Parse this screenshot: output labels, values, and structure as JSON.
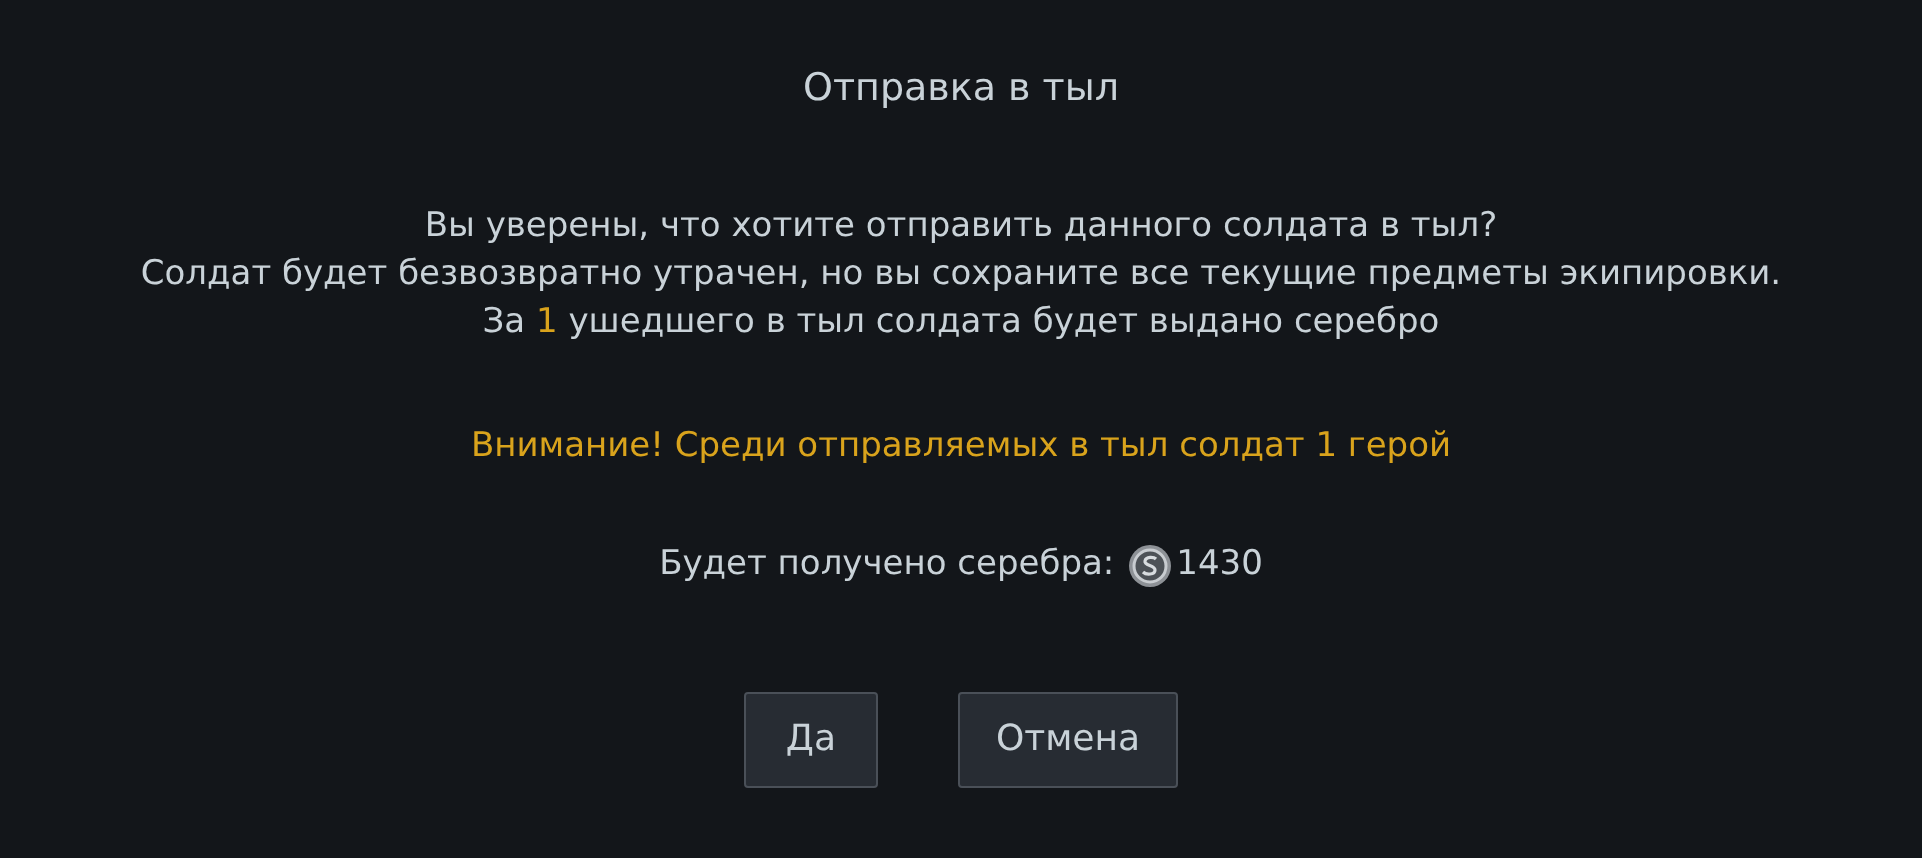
{
  "dialog": {
    "title": "Отправка в тыл",
    "message_lines": [
      "Вы уверены, что хотите отправить данного солдата в тыл?",
      "Солдат будет безвозвратно утрачен, но вы сохраните все текущие предметы экипировки."
    ],
    "reward_line": {
      "prefix": "За",
      "count": "1",
      "suffix": "ушедшего в тыл солдата будет выдано серебро"
    },
    "warning": "Внимание! Среди отправляемых в тыл солдат 1 герой",
    "silver": {
      "label": "Будет получено серебра:",
      "amount": "1430"
    },
    "buttons": [
      {
        "label": "Да"
      },
      {
        "label": "Отмена"
      }
    ]
  }
}
